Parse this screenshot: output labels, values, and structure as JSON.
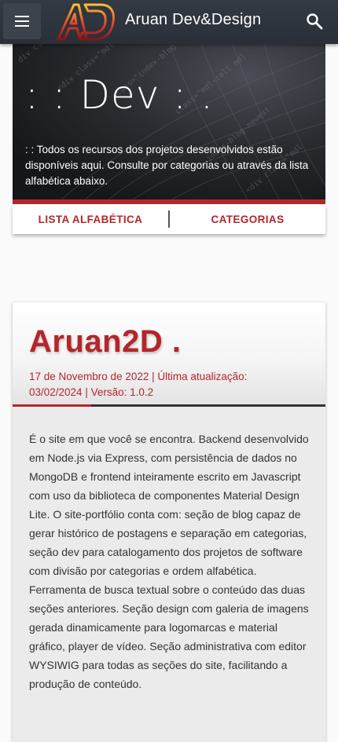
{
  "appbar": {
    "title": "Aruan Dev&Design",
    "menu_icon": "menu-icon",
    "logo_text": "AD",
    "search_icon": "search-icon"
  },
  "hero": {
    "title": ": : Dev : .",
    "description": ": : Todos os recursos dos projetos desenvolvidos estão disponíveis aqui. Consulte por categorias ou através da lista alfabética abaixo.",
    "actions": {
      "alphabetical": "LISTA ALFABÉTICA",
      "categories": "CATEGORIAS"
    }
  },
  "project": {
    "title": "Aruan2D .",
    "meta": "17 de Novembro de 2022 | Última atualização: 03/02/2024 | Versão: 1.0.2",
    "description": "É o site em que você se encontra. Backend desenvolvido em Node.js via Express, com persistência de dados no MongoDB e frontend inteiramente escrito em Javascript com uso da biblioteca de componentes Material Design Lite. O site-portfólio conta com: seção de blog capaz de gerar histórico de postagens e separação em categorias, seção dev para catalogamento dos projetos de software com divisão por categorias e ordem alfabética. Ferramenta de busca textual sobre o conteúdo das duas seções anteriores. Seção design com galeria de imagens gerada dinamicamente para logomarcas e material gráfico, player de vídeo. Seção administrativa com editor WYSIWIG para todas as seções do site, facilitando a produção de conteúdo."
  },
  "colors": {
    "accent": "#b3262a",
    "appbar": "#2e343c",
    "hero_bg": "#1f2126",
    "card_bg": "#ebebeb"
  }
}
